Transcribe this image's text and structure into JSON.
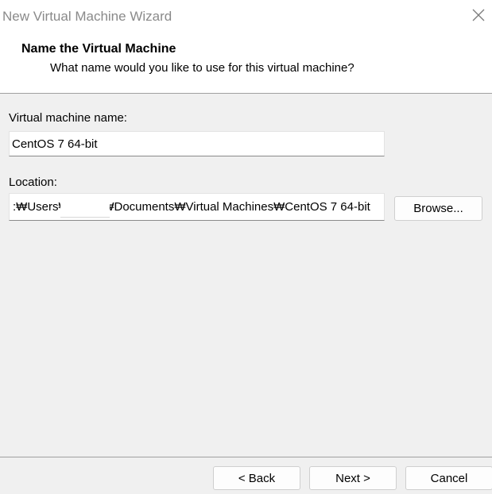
{
  "window": {
    "title": "New Virtual Machine Wizard",
    "close_icon": "close-icon"
  },
  "header": {
    "title": "Name the Virtual Machine",
    "subtitle": "What name would you like to use for this virtual machine?"
  },
  "form": {
    "name_label": "Virtual machine name:",
    "name_value": "CentOS 7 64-bit",
    "location_label": "Location:",
    "location_value": ":₩Users₩          ₩Documents₩Virtual Machines₩CentOS 7 64-bit",
    "browse_label": "Browse..."
  },
  "footer": {
    "back_label": "< Back",
    "next_label": "Next >",
    "cancel_label": "Cancel"
  }
}
